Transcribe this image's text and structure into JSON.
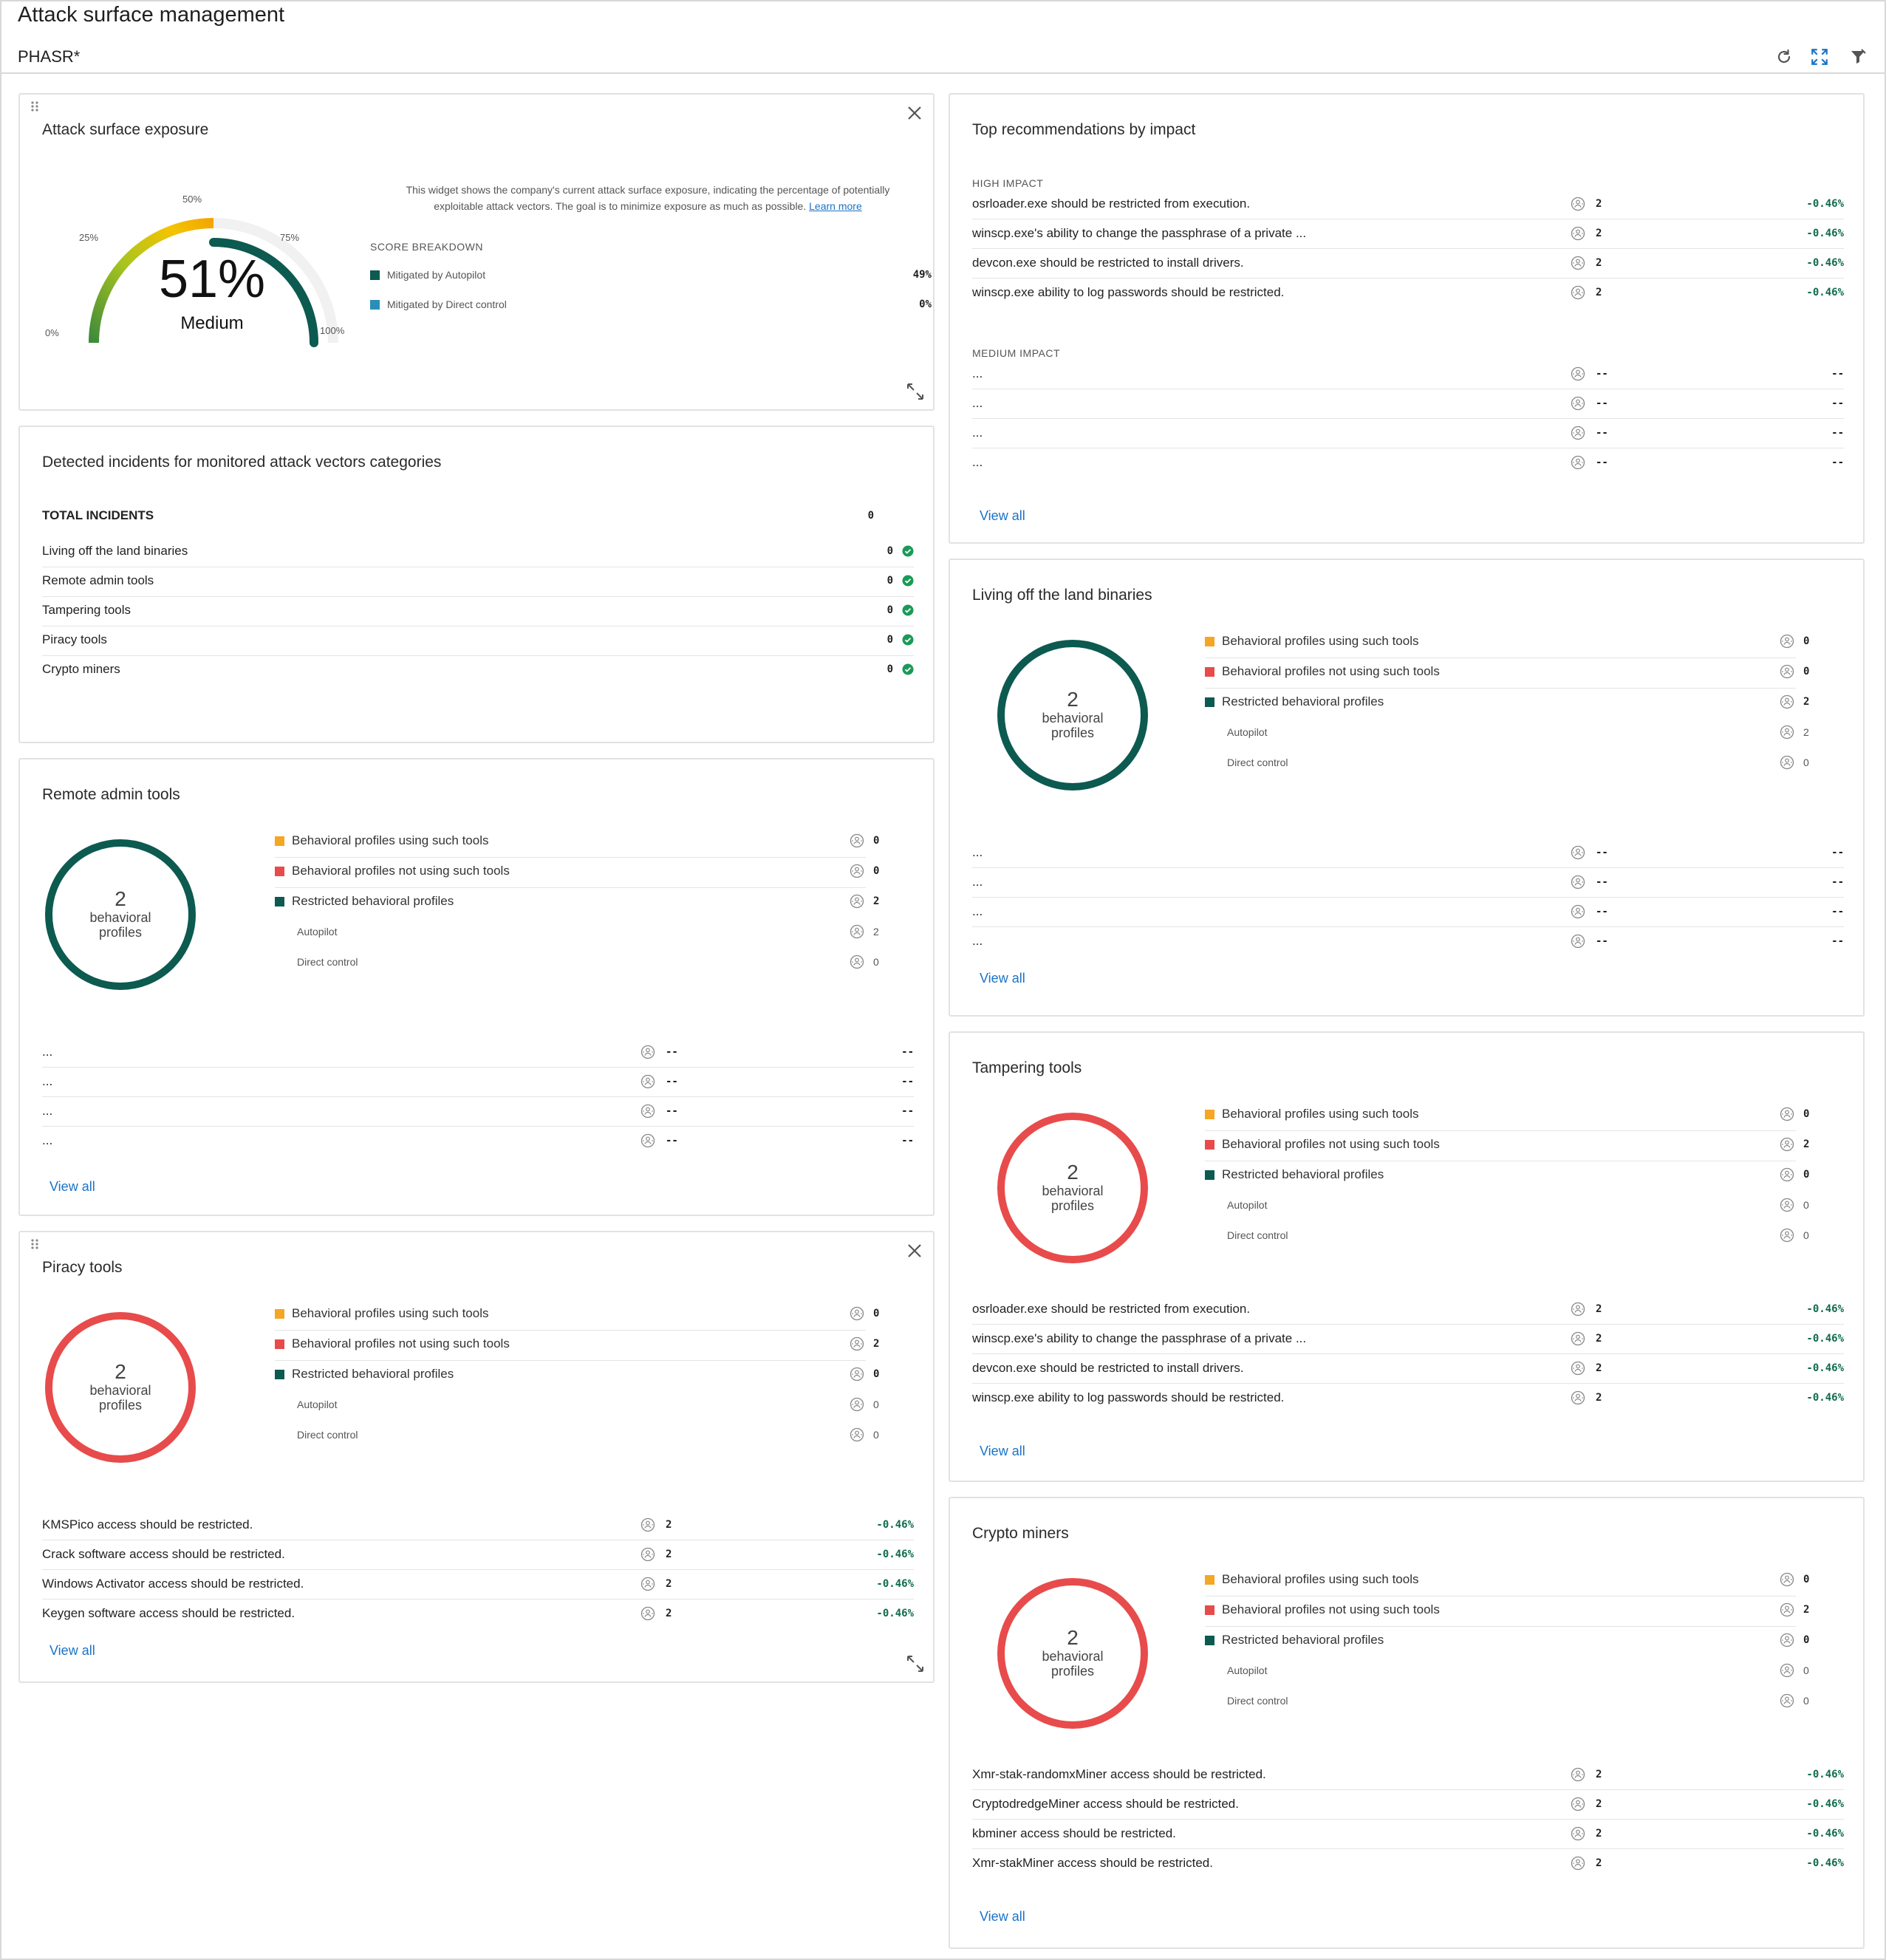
{
  "header": {
    "title": "Attack surface management",
    "company": "PHASR*",
    "icons": [
      "refresh-icon",
      "fullscreen-icon",
      "filter-icon"
    ]
  },
  "colors": {
    "teal": "#0c5a50",
    "red": "#e84b4b",
    "orange": "#f5a623",
    "blue_square": "#2a8fb8",
    "green": "#1a9a57",
    "link": "#1a73c8"
  },
  "exposure": {
    "title": "Attack surface exposure",
    "percent_text": "51%",
    "score_value": 51,
    "level": "Medium",
    "ticks": [
      "0%",
      "25%",
      "50%",
      "75%",
      "100%"
    ],
    "description_line1": "This widget shows the company's current attack surface exposure, indicating the percentage of potentially",
    "description_line2": "exploitable attack vectors. The goal is to minimize exposure as much as possible.",
    "learn_more": "Learn more",
    "breakdown_title": "SCORE BREAKDOWN",
    "breakdown": [
      {
        "label": "Mitigated by Autopilot",
        "value": "49%"
      },
      {
        "label": "Mitigated by Direct control",
        "value": "0%"
      }
    ]
  },
  "incidents": {
    "title": "Detected incidents for monitored attack vectors categories",
    "total_label": "TOTAL INCIDENTS",
    "total_value": "0",
    "rows": [
      {
        "label": "Living off the land binaries",
        "value": "0"
      },
      {
        "label": "Remote admin tools",
        "value": "0"
      },
      {
        "label": "Tampering tools",
        "value": "0"
      },
      {
        "label": "Piracy tools",
        "value": "0"
      },
      {
        "label": "Crypto miners",
        "value": "0"
      }
    ]
  },
  "profile_legend": {
    "using": "Behavioral profiles using such tools",
    "not_using": "Behavioral profiles not using such tools",
    "restricted": "Restricted behavioral profiles",
    "autopilot": "Autopilot",
    "direct": "Direct control"
  },
  "donut_text": {
    "count": "2",
    "line1": "behavioral",
    "line2": "profiles"
  },
  "remote_admin": {
    "title": "Remote admin tools",
    "values": {
      "using": "0",
      "not_using": "0",
      "restricted": "2",
      "autopilot": "2",
      "direct": "0"
    },
    "rows": [
      {
        "label": "...",
        "count": "--",
        "pct": "--"
      },
      {
        "label": "...",
        "count": "--",
        "pct": "--"
      },
      {
        "label": "...",
        "count": "--",
        "pct": "--"
      },
      {
        "label": "...",
        "count": "--",
        "pct": "--"
      }
    ],
    "view_all": "View all"
  },
  "piracy": {
    "title": "Piracy tools",
    "values": {
      "using": "0",
      "not_using": "2",
      "restricted": "0",
      "autopilot": "0",
      "direct": "0"
    },
    "rows": [
      {
        "label": "KMSPico access should be restricted.",
        "count": "2",
        "pct": "-0.46%"
      },
      {
        "label": "Crack software access should be restricted.",
        "count": "2",
        "pct": "-0.46%"
      },
      {
        "label": "Windows Activator access should be restricted.",
        "count": "2",
        "pct": "-0.46%"
      },
      {
        "label": "Keygen software access should be restricted.",
        "count": "2",
        "pct": "-0.46%"
      }
    ],
    "view_all": "View all"
  },
  "top_recs": {
    "title": "Top recommendations by impact",
    "high_label": "HIGH IMPACT",
    "high": [
      {
        "label": "osrloader.exe should be restricted from execution.",
        "count": "2",
        "pct": "-0.46%"
      },
      {
        "label": "winscp.exe's ability to change the passphrase of a private ...",
        "count": "2",
        "pct": "-0.46%"
      },
      {
        "label": "devcon.exe should be restricted to install drivers.",
        "count": "2",
        "pct": "-0.46%"
      },
      {
        "label": "winscp.exe ability to log passwords should be restricted.",
        "count": "2",
        "pct": "-0.46%"
      }
    ],
    "medium_label": "MEDIUM IMPACT",
    "medium": [
      {
        "label": "...",
        "count": "--",
        "pct": "--"
      },
      {
        "label": "...",
        "count": "--",
        "pct": "--"
      },
      {
        "label": "...",
        "count": "--",
        "pct": "--"
      },
      {
        "label": "...",
        "count": "--",
        "pct": "--"
      }
    ],
    "view_all": "View all"
  },
  "lotl": {
    "title": "Living off the land binaries",
    "values": {
      "using": "0",
      "not_using": "0",
      "restricted": "2",
      "autopilot": "2",
      "direct": "0"
    },
    "rows": [
      {
        "label": "...",
        "count": "--",
        "pct": "--"
      },
      {
        "label": "...",
        "count": "--",
        "pct": "--"
      },
      {
        "label": "...",
        "count": "--",
        "pct": "--"
      },
      {
        "label": "...",
        "count": "--",
        "pct": "--"
      }
    ],
    "view_all": "View all"
  },
  "tampering": {
    "title": "Tampering tools",
    "values": {
      "using": "0",
      "not_using": "2",
      "restricted": "0",
      "autopilot": "0",
      "direct": "0"
    },
    "rows": [
      {
        "label": "osrloader.exe should be restricted from execution.",
        "count": "2",
        "pct": "-0.46%"
      },
      {
        "label": "winscp.exe's ability to change the passphrase of a private ...",
        "count": "2",
        "pct": "-0.46%"
      },
      {
        "label": "devcon.exe should be restricted to install drivers.",
        "count": "2",
        "pct": "-0.46%"
      },
      {
        "label": "winscp.exe ability to log passwords should be restricted.",
        "count": "2",
        "pct": "-0.46%"
      }
    ],
    "view_all": "View all"
  },
  "crypto": {
    "title": "Crypto miners",
    "values": {
      "using": "0",
      "not_using": "2",
      "restricted": "0",
      "autopilot": "0",
      "direct": "0"
    },
    "rows": [
      {
        "label": "Xmr-stak-randomxMiner access should be restricted.",
        "count": "2",
        "pct": "-0.46%"
      },
      {
        "label": "CryptodredgeMiner access should be restricted.",
        "count": "2",
        "pct": "-0.46%"
      },
      {
        "label": "kbminer access should be restricted.",
        "count": "2",
        "pct": "-0.46%"
      },
      {
        "label": "Xmr-stakMiner access should be restricted.",
        "count": "2",
        "pct": "-0.46%"
      }
    ],
    "view_all": "View all"
  }
}
